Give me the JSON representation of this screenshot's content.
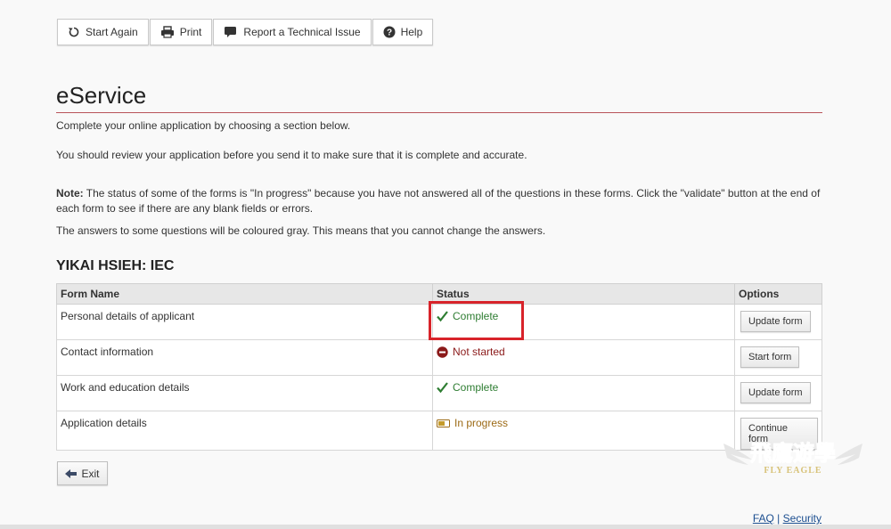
{
  "toolbar": {
    "start_again": "Start Again",
    "print": "Print",
    "report": "Report a Technical Issue",
    "help": "Help"
  },
  "page": {
    "title": "eService",
    "intro": "Complete your online application by choosing a section below.",
    "review": "You should review your application before you send it to make sure that it is complete and accurate.",
    "note_label": "Note:",
    "note_text": " The status of some of the forms is \"In progress\" because you have not answered all of the questions in these forms. Click the \"validate\" button at the end of each form to see if there are any blank fields or errors.",
    "gray_note": "The answers to some questions will be coloured gray. This means that you cannot change the answers."
  },
  "applicant": {
    "heading": "YIKAI HSIEH: IEC"
  },
  "table": {
    "headers": {
      "form_name": "Form Name",
      "status": "Status",
      "options": "Options"
    },
    "rows": [
      {
        "form": "Personal details of applicant",
        "status": "Complete",
        "action": "Update form"
      },
      {
        "form": "Contact information",
        "status": "Not started",
        "action": "Start form"
      },
      {
        "form": "Work and education details",
        "status": "Complete",
        "action": "Update form"
      },
      {
        "form": "Application details",
        "status": "In progress",
        "action": "Continue form"
      }
    ]
  },
  "exit": {
    "label": "Exit"
  },
  "footer": {
    "faq": "FAQ",
    "separator": " | ",
    "security": "Security"
  },
  "watermark": {
    "line1": "飛鷹遊學",
    "line2": "FLY EAGLE"
  },
  "colors": {
    "complete": "#2e7d32",
    "not_started": "#8b1a1a",
    "in_progress": "#9c6a15",
    "highlight": "#d8232a",
    "title_rule": "#b9535a"
  }
}
